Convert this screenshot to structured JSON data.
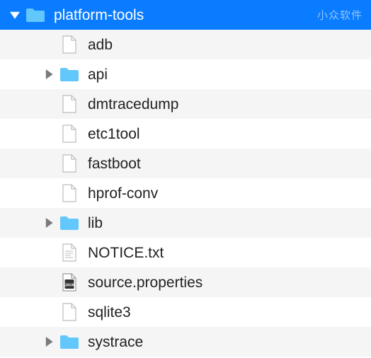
{
  "watermark": "小众软件",
  "colors": {
    "selection": "#0a7cff",
    "folder": "#62c7fb",
    "alt_row": "#f5f5f5",
    "disclosure_dark": "#7a7a7a",
    "disclosure_light": "#ffffff"
  },
  "root": {
    "name": "platform-tools",
    "expanded": true,
    "selected": true,
    "type": "folder",
    "children": [
      {
        "name": "adb",
        "type": "file"
      },
      {
        "name": "api",
        "type": "folder",
        "expanded": false
      },
      {
        "name": "dmtracedump",
        "type": "file"
      },
      {
        "name": "etc1tool",
        "type": "file"
      },
      {
        "name": "fastboot",
        "type": "file"
      },
      {
        "name": "hprof-conv",
        "type": "file"
      },
      {
        "name": "lib",
        "type": "folder",
        "expanded": false
      },
      {
        "name": "NOTICE.txt",
        "type": "text"
      },
      {
        "name": "source.properties",
        "type": "java-prop"
      },
      {
        "name": "sqlite3",
        "type": "file"
      },
      {
        "name": "systrace",
        "type": "folder",
        "expanded": false
      }
    ]
  }
}
